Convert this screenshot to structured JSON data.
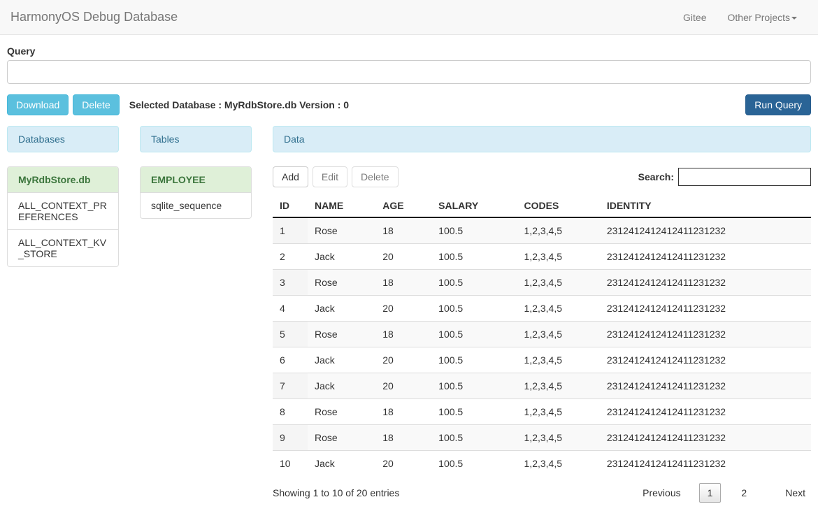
{
  "navbar": {
    "brand": "HarmonyOS Debug Database",
    "links": {
      "gitee": "Gitee",
      "other": "Other Projects"
    }
  },
  "query": {
    "label": "Query",
    "value": ""
  },
  "toolbar": {
    "download": "Download",
    "delete": "Delete",
    "selected": "Selected Database : MyRdbStore.db Version : 0",
    "run": "Run Query"
  },
  "panels": {
    "databases": "Databases",
    "tables": "Tables",
    "data": "Data"
  },
  "databases": [
    {
      "name": "MyRdbStore.db",
      "active": true
    },
    {
      "name": "ALL_CONTEXT_PREFERENCES",
      "active": false
    },
    {
      "name": "ALL_CONTEXT_KV_STORE",
      "active": false
    }
  ],
  "tables": [
    {
      "name": "EMPLOYEE",
      "active": true
    },
    {
      "name": "sqlite_sequence",
      "active": false
    }
  ],
  "data_toolbar": {
    "add": "Add",
    "edit": "Edit",
    "delete": "Delete",
    "search_label": "Search:",
    "search_value": ""
  },
  "columns": [
    "ID",
    "NAME",
    "AGE",
    "SALARY",
    "CODES",
    "IDENTITY"
  ],
  "rows": [
    [
      "1",
      "Rose",
      "18",
      "100.5",
      "1,2,3,4,5",
      "2312412412412411231232"
    ],
    [
      "2",
      "Jack",
      "20",
      "100.5",
      "1,2,3,4,5",
      "2312412412412411231232"
    ],
    [
      "3",
      "Rose",
      "18",
      "100.5",
      "1,2,3,4,5",
      "2312412412412411231232"
    ],
    [
      "4",
      "Jack",
      "20",
      "100.5",
      "1,2,3,4,5",
      "2312412412412411231232"
    ],
    [
      "5",
      "Rose",
      "18",
      "100.5",
      "1,2,3,4,5",
      "2312412412412411231232"
    ],
    [
      "6",
      "Jack",
      "20",
      "100.5",
      "1,2,3,4,5",
      "2312412412412411231232"
    ],
    [
      "7",
      "Jack",
      "20",
      "100.5",
      "1,2,3,4,5",
      "2312412412412411231232"
    ],
    [
      "8",
      "Rose",
      "18",
      "100.5",
      "1,2,3,4,5",
      "2312412412412411231232"
    ],
    [
      "9",
      "Rose",
      "18",
      "100.5",
      "1,2,3,4,5",
      "2312412412412411231232"
    ],
    [
      "10",
      "Jack",
      "20",
      "100.5",
      "1,2,3,4,5",
      "2312412412412411231232"
    ]
  ],
  "footer": {
    "info": "Showing 1 to 10 of 20 entries",
    "previous": "Previous",
    "next": "Next",
    "pages": [
      "1",
      "2"
    ],
    "active_page": "1"
  }
}
